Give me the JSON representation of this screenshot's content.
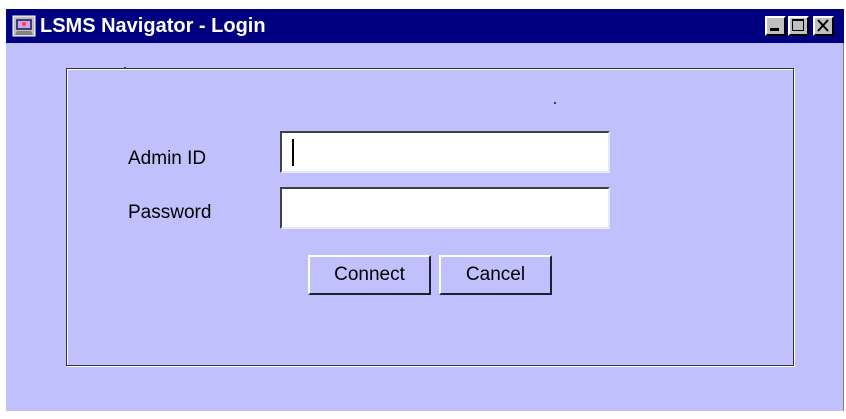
{
  "window": {
    "title": "LSMS Navigator - Login",
    "app_icon": "app-logo-icon",
    "controls": {
      "minimize_icon": "minimize-icon",
      "maximize_icon": "maximize-icon",
      "close_icon": "close-icon"
    }
  },
  "form": {
    "admin_id_label": "Admin ID",
    "admin_id_value": "",
    "password_label": "Password",
    "password_value": ""
  },
  "buttons": {
    "connect_label": "Connect",
    "cancel_label": "Cancel"
  },
  "colors": {
    "titlebar": "#000080",
    "window_background": "#c0c0fc",
    "field_background": "#ffffff"
  }
}
